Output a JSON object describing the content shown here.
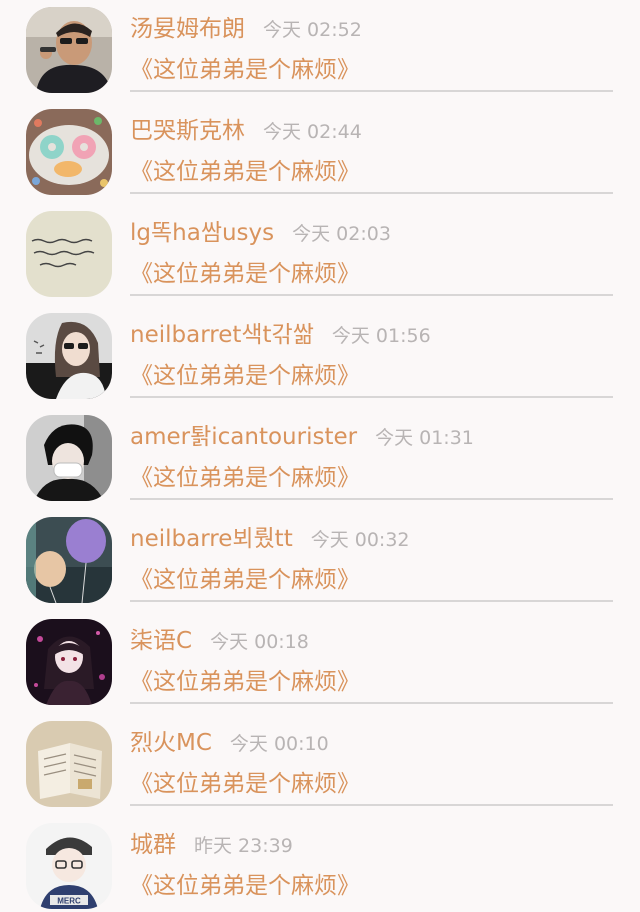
{
  "conversations": [
    {
      "name": "汤妟姆布朗",
      "time": "今天 02:52",
      "message": "《这位弟弟是个麻烦》",
      "avatar_icon": "avatar-man-sunglasses-icon"
    },
    {
      "name": "巴哭斯克林",
      "time": "今天 02:44",
      "message": "《这位弟弟是个麻烦》",
      "avatar_icon": "avatar-donuts-icon"
    },
    {
      "name": "lg똑ha쌈usys",
      "time": "今天 02:03",
      "message": "《这位弟弟是个麻烦》",
      "avatar_icon": "avatar-handwriting-icon"
    },
    {
      "name": "neilbarret색t갂쌂",
      "time": "今天 01:56",
      "message": "《这位弟弟是个麻烦》",
      "avatar_icon": "avatar-woman-sunglasses-icon"
    },
    {
      "name": "amer퇅icantourister",
      "time": "今天 01:31",
      "message": "《这位弟弟是个麻烦》",
      "avatar_icon": "avatar-masked-person-icon"
    },
    {
      "name": "neilbarre뵈뤘tt",
      "time": "今天 00:32",
      "message": "《这位弟弟是个麻烦》",
      "avatar_icon": "avatar-balloons-icon"
    },
    {
      "name": "柒语C",
      "time": "今天 00:18",
      "message": "《这位弟弟是个麻烦》",
      "avatar_icon": "avatar-anime-girl-icon"
    },
    {
      "name": "烈火MC",
      "time": "今天 00:10",
      "message": "《这位弟弟是个麻烦》",
      "avatar_icon": "avatar-open-book-icon"
    },
    {
      "name": "城群",
      "time": "昨天 23:39",
      "message": "《这位弟弟是个麻烦》",
      "avatar_icon": "avatar-cartoon-boy-icon"
    }
  ],
  "colors": {
    "background": "#fbf8f8",
    "accent": "#d9935c",
    "time": "#b8b4b4",
    "divider": "#d8d6d6"
  }
}
